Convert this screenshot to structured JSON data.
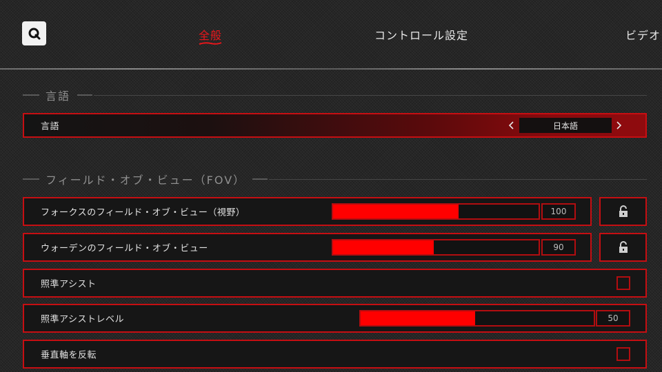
{
  "tabs": [
    {
      "label": "全般",
      "active": true
    },
    {
      "label": "コントロール設定",
      "active": false
    },
    {
      "label": "ビデオ",
      "active": false
    }
  ],
  "logo": {
    "letter": "Q",
    "icon": "magnifier-logo-icon"
  },
  "sections": {
    "language": {
      "title": "言語",
      "row": {
        "label": "言語",
        "value": "日本語",
        "prev_icon": "chevron-left-icon",
        "next_icon": "chevron-right-icon"
      }
    },
    "fov": {
      "title": "フィールド・オブ・ビュー（FOV）",
      "rows": [
        {
          "label": "フォークスのフィールド・オブ・ビュー（視野）",
          "value": "100",
          "fill_fraction": 0.61,
          "locked": true
        },
        {
          "label": "ウォーデンのフィールド・オブ・ビュー",
          "value": "90",
          "fill_fraction": 0.49,
          "locked": true
        },
        {
          "label": "照準アシスト",
          "type": "checkbox",
          "checked": false
        },
        {
          "label": "照準アシストレベル",
          "value": "50",
          "fill_fraction": 0.49
        },
        {
          "label": "垂直軸を反転",
          "type": "checkbox",
          "checked": false
        }
      ]
    }
  },
  "colors": {
    "accent": "#e8161b",
    "fill": "#ff0000",
    "border": "#c70e12"
  }
}
